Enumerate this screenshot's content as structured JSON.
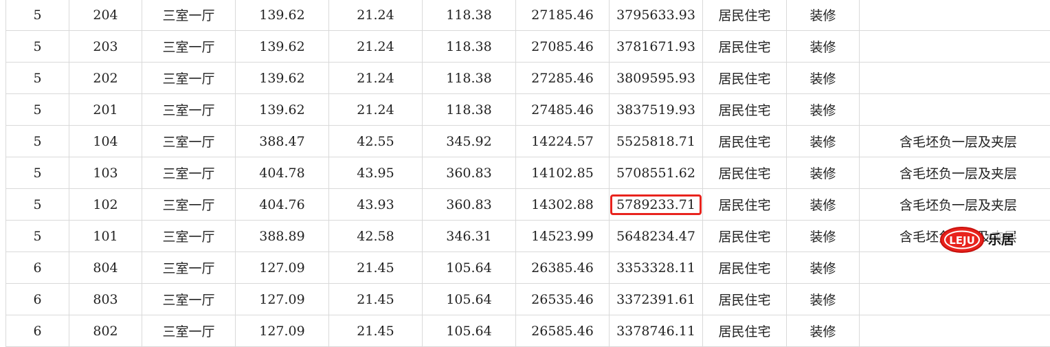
{
  "rows": [
    [
      "5",
      "204",
      "三室一厅",
      "139.62",
      "21.24",
      "118.38",
      "27185.46",
      "3795633.93",
      "居民住宅",
      "装修",
      ""
    ],
    [
      "5",
      "203",
      "三室一厅",
      "139.62",
      "21.24",
      "118.38",
      "27085.46",
      "3781671.93",
      "居民住宅",
      "装修",
      ""
    ],
    [
      "5",
      "202",
      "三室一厅",
      "139.62",
      "21.24",
      "118.38",
      "27285.46",
      "3809595.93",
      "居民住宅",
      "装修",
      ""
    ],
    [
      "5",
      "201",
      "三室一厅",
      "139.62",
      "21.24",
      "118.38",
      "27485.46",
      "3837519.93",
      "居民住宅",
      "装修",
      ""
    ],
    [
      "5",
      "104",
      "三室一厅",
      "388.47",
      "42.55",
      "345.92",
      "14224.57",
      "5525818.71",
      "居民住宅",
      "装修",
      "含毛坯负一层及夹层"
    ],
    [
      "5",
      "103",
      "三室一厅",
      "404.78",
      "43.95",
      "360.83",
      "14102.85",
      "5708551.62",
      "居民住宅",
      "装修",
      "含毛坯负一层及夹层"
    ],
    [
      "5",
      "102",
      "三室一厅",
      "404.76",
      "43.93",
      "360.83",
      "14302.88",
      "5789233.71",
      "居民住宅",
      "装修",
      "含毛坯负一层及夹层"
    ],
    [
      "5",
      "101",
      "三室一厅",
      "388.89",
      "42.58",
      "346.31",
      "14523.99",
      "5648234.47",
      "居民住宅",
      "装修",
      "含毛坯负一层及夹层"
    ],
    [
      "6",
      "804",
      "三室一厅",
      "127.09",
      "21.45",
      "105.64",
      "26385.46",
      "3353328.11",
      "居民住宅",
      "装修",
      ""
    ],
    [
      "6",
      "803",
      "三室一厅",
      "127.09",
      "21.45",
      "105.64",
      "26535.46",
      "3372391.61",
      "居民住宅",
      "装修",
      ""
    ],
    [
      "6",
      "802",
      "三室一厅",
      "127.09",
      "21.45",
      "105.64",
      "26585.46",
      "3378746.11",
      "居民住宅",
      "装修",
      ""
    ]
  ],
  "highlight": {
    "row": 6,
    "col": 7,
    "color": "#e8231d"
  },
  "watermark": {
    "logo_text": "LEJU",
    "text": "乐居",
    "color": "#e8231d"
  }
}
